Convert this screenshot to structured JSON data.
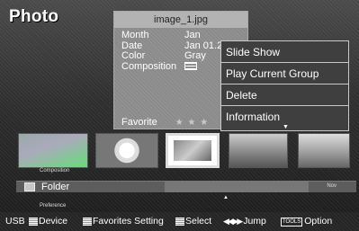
{
  "app": {
    "title": "Photo"
  },
  "info": {
    "filename": "image_1.jpg",
    "rows": [
      {
        "label": "Month",
        "value": "Jan"
      },
      {
        "label": "Date",
        "value": "Jan 01.2"
      },
      {
        "label": "Color",
        "value": "Gray"
      },
      {
        "label": "Composition",
        "value": ""
      }
    ],
    "favorite_label": "Favorite",
    "favorite_stars": "★ ★ ★"
  },
  "menu": {
    "items": [
      {
        "label": "Slide Show"
      },
      {
        "label": "Play Current Group"
      },
      {
        "label": "Delete"
      },
      {
        "label": "Information"
      }
    ],
    "more_indicator": "▼"
  },
  "strip": {
    "composition_label": "Composition",
    "preference_label": "Preference",
    "folder_label": "Folder",
    "nav_label": "Nov",
    "up_arrow": "▲"
  },
  "bottom_bar": {
    "source": "USB",
    "device": "Device",
    "favorites": "Favorites Setting",
    "select": "Select",
    "jump": "Jump",
    "tools_key": "TOOLS",
    "option": "Option",
    "jump_arrows": "◀◀ ▶▶"
  }
}
